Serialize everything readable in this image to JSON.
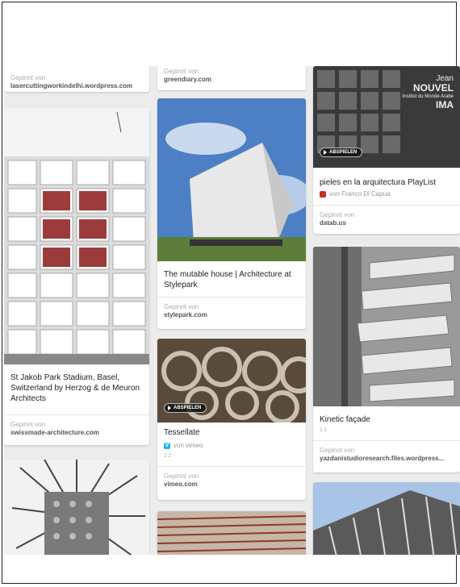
{
  "pins": {
    "col1_top": {
      "pinned_label": "Gepinnt von",
      "source": "lasercuttingworkindelhi.wordpress.com"
    },
    "stadium": {
      "caption": "St Jakob Park Stadium, Basel, Switzerland by Herzog & de Meuron Architects",
      "pinned_label": "Gepinnt von",
      "source": "swissmade-architecture.com"
    },
    "col2_top": {
      "pinned_label": "Gepinnt von",
      "source": "greendiary.com"
    },
    "mutable_house": {
      "caption": "The mutable house | Architecture at Stylepark",
      "pinned_label": "Gepinnt von",
      "source": "stylepark.com"
    },
    "tessellate": {
      "caption": "Tessellate",
      "play_label": "ABSPIELEN",
      "via_label": "von vimeo",
      "stats": "1 2",
      "pinned_label": "Gepinnt von",
      "source": "vimeo.com"
    },
    "pieles": {
      "overlay_line1": "Jean",
      "overlay_line2": "NOUVEL",
      "overlay_line3": "Institut du Monde Arabe",
      "overlay_line4": "IMA",
      "play_label": "ABSPIELEN",
      "caption": "pieles en la arquitectura PlayList",
      "via_label": "von Franco Di Capua",
      "pinned_label": "Gepinnt von",
      "source": "datab.us"
    },
    "kinetic": {
      "caption": "Kinetic façade",
      "stats": "1 1",
      "pinned_label": "Gepinnt von",
      "source": "yazdanistudioresearch.files.wordpress..."
    }
  },
  "colors": {
    "board_bg": "#ececec",
    "sky": "#4d7fc4",
    "youtube": "#c4302b",
    "vimeo": "#1ab7ea"
  }
}
